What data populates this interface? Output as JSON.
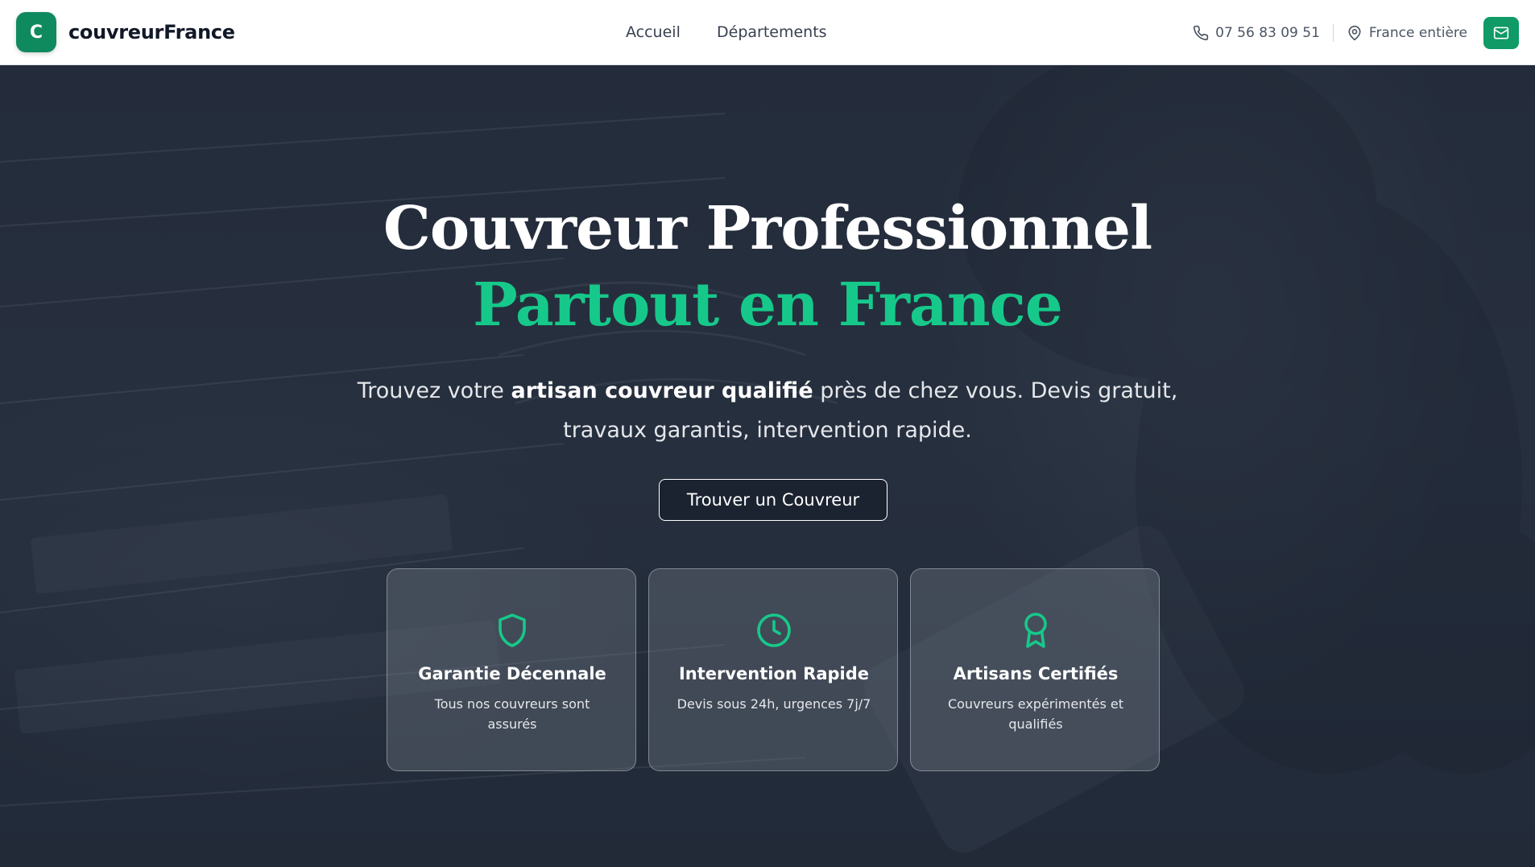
{
  "brand": {
    "logo_letter": "C",
    "name": "couvreurFrance"
  },
  "nav": {
    "items": [
      {
        "label": "Accueil"
      },
      {
        "label": "Départements"
      }
    ]
  },
  "contact": {
    "phone": "07 56 83 09 51",
    "location": "France entière",
    "mail_icon": "mail-icon"
  },
  "hero": {
    "title_line1": "Couvreur Professionnel",
    "title_line2": "Partout en France",
    "subtitle_before": "Trouvez votre ",
    "subtitle_bold": "artisan couvreur qualifié",
    "subtitle_after": " près de chez vous. Devis gratuit, travaux garantis, intervention rapide.",
    "cta_label": "Trouver un Couvreur"
  },
  "features": [
    {
      "icon": "shield-icon",
      "title": "Garantie Décennale",
      "description": "Tous nos couvreurs sont assurés"
    },
    {
      "icon": "clock-icon",
      "title": "Intervention Rapide",
      "description": "Devis sous 24h, urgences 7j/7"
    },
    {
      "icon": "award-icon",
      "title": "Artisans Certifiés",
      "description": "Couvreurs expérimentés et qualifiés"
    }
  ],
  "colors": {
    "accent": "#16c98a",
    "brand_green": "#0f8a5f",
    "hero_bg": "#2b3544"
  }
}
